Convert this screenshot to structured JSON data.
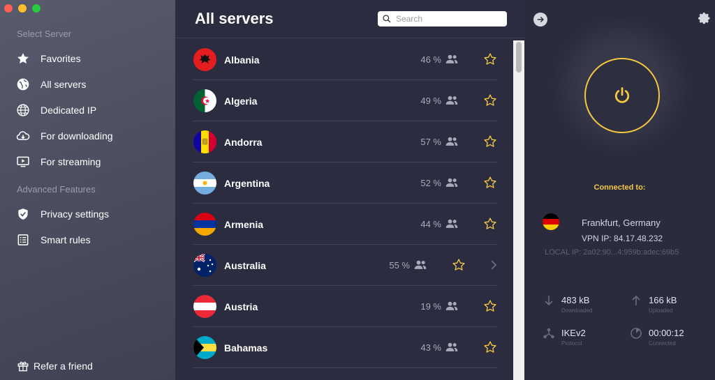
{
  "window": {
    "traffic_colors": [
      "#ff5f57",
      "#febc2e",
      "#28c840"
    ]
  },
  "sidebar": {
    "section1": "Select Server",
    "items": [
      {
        "label": "Favorites",
        "icon": "star-icon"
      },
      {
        "label": "All servers",
        "icon": "globe-icon"
      },
      {
        "label": "Dedicated IP",
        "icon": "dedicated-ip-icon"
      },
      {
        "label": "For downloading",
        "icon": "cloud-download-icon"
      },
      {
        "label": "For streaming",
        "icon": "tv-play-icon"
      }
    ],
    "section2": "Advanced Features",
    "items2": [
      {
        "label": "Privacy settings",
        "icon": "shield-check-icon"
      },
      {
        "label": "Smart rules",
        "icon": "rules-list-icon"
      }
    ],
    "refer": "Refer a friend"
  },
  "list": {
    "title": "All servers",
    "search_placeholder": "Search",
    "servers": [
      {
        "country": "Albania",
        "load": "46 %"
      },
      {
        "country": "Algeria",
        "load": "49 %"
      },
      {
        "country": "Andorra",
        "load": "57 %"
      },
      {
        "country": "Argentina",
        "load": "52 %"
      },
      {
        "country": "Armenia",
        "load": "44 %"
      },
      {
        "country": "Australia",
        "load": "55 %"
      },
      {
        "country": "Austria",
        "load": "19 %"
      },
      {
        "country": "Bahamas",
        "load": "43 %"
      }
    ]
  },
  "connection": {
    "status": "Connected to:",
    "location": "Frankfurt, Germany",
    "vpn_ip": "VPN IP: 84.17.48.232",
    "local_ip": "LOCAL IP: 2a02:90...4:959b:adec:69b5",
    "downloaded": "483 kB",
    "downloaded_label": "Downloaded",
    "uploaded": "166 kB",
    "uploaded_label": "Uploaded",
    "protocol": "IKEv2",
    "protocol_label": "Protocol",
    "connected_time": "00:00:12",
    "connected_label": "Connected",
    "accent": "#f5c842"
  }
}
